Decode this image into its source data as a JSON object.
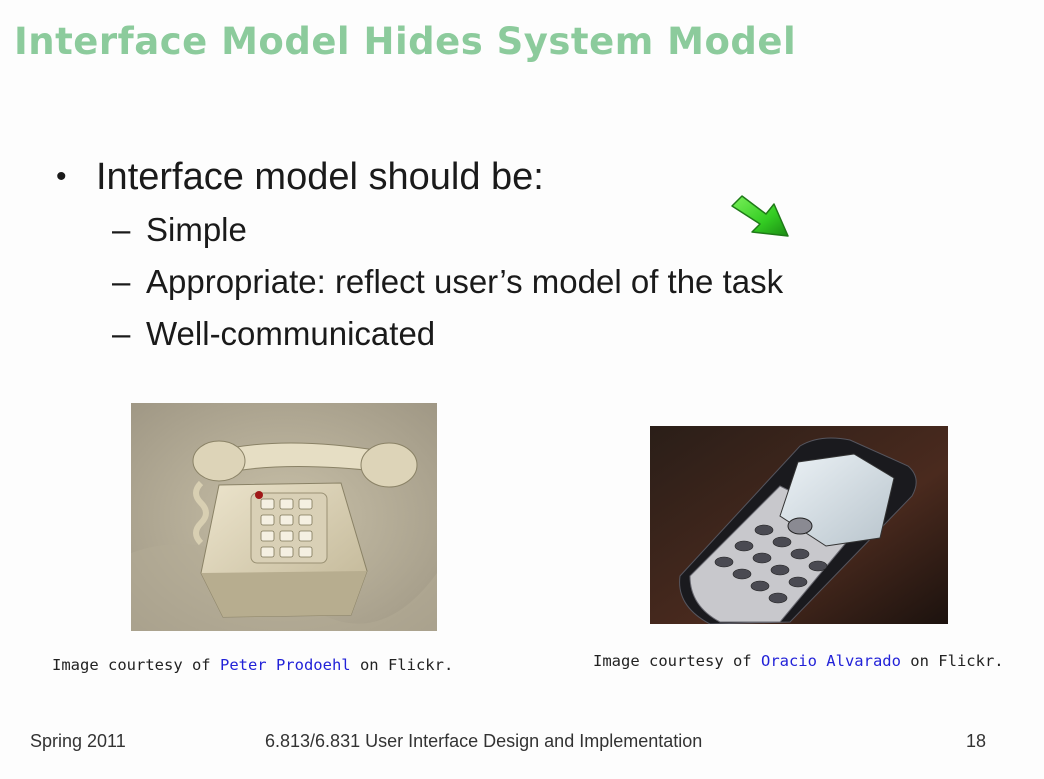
{
  "title": "Interface Model Hides System Model",
  "bullet": {
    "marker": "•",
    "text": "Interface model should be:",
    "sub_marker": "–",
    "subitems": [
      "Simple",
      "Appropriate: reflect user’s model of the task",
      "Well-communicated"
    ]
  },
  "cursor_icon": "green-arrow-icon",
  "captions": {
    "left": {
      "prefix": "Image courtesy of ",
      "link": "Peter Prodoehl",
      "suffix": " on Flickr."
    },
    "right": {
      "prefix": "Image courtesy of ",
      "link": "Oracio Alvarado",
      "suffix": " on Flickr."
    }
  },
  "footer": {
    "left": "Spring 2011",
    "center": "6.813/6.831 User Interface Design and Implementation",
    "right": "18"
  },
  "colors": {
    "title": "#8ccb9c",
    "link": "#2222d8",
    "arrow": "#33cc22"
  }
}
